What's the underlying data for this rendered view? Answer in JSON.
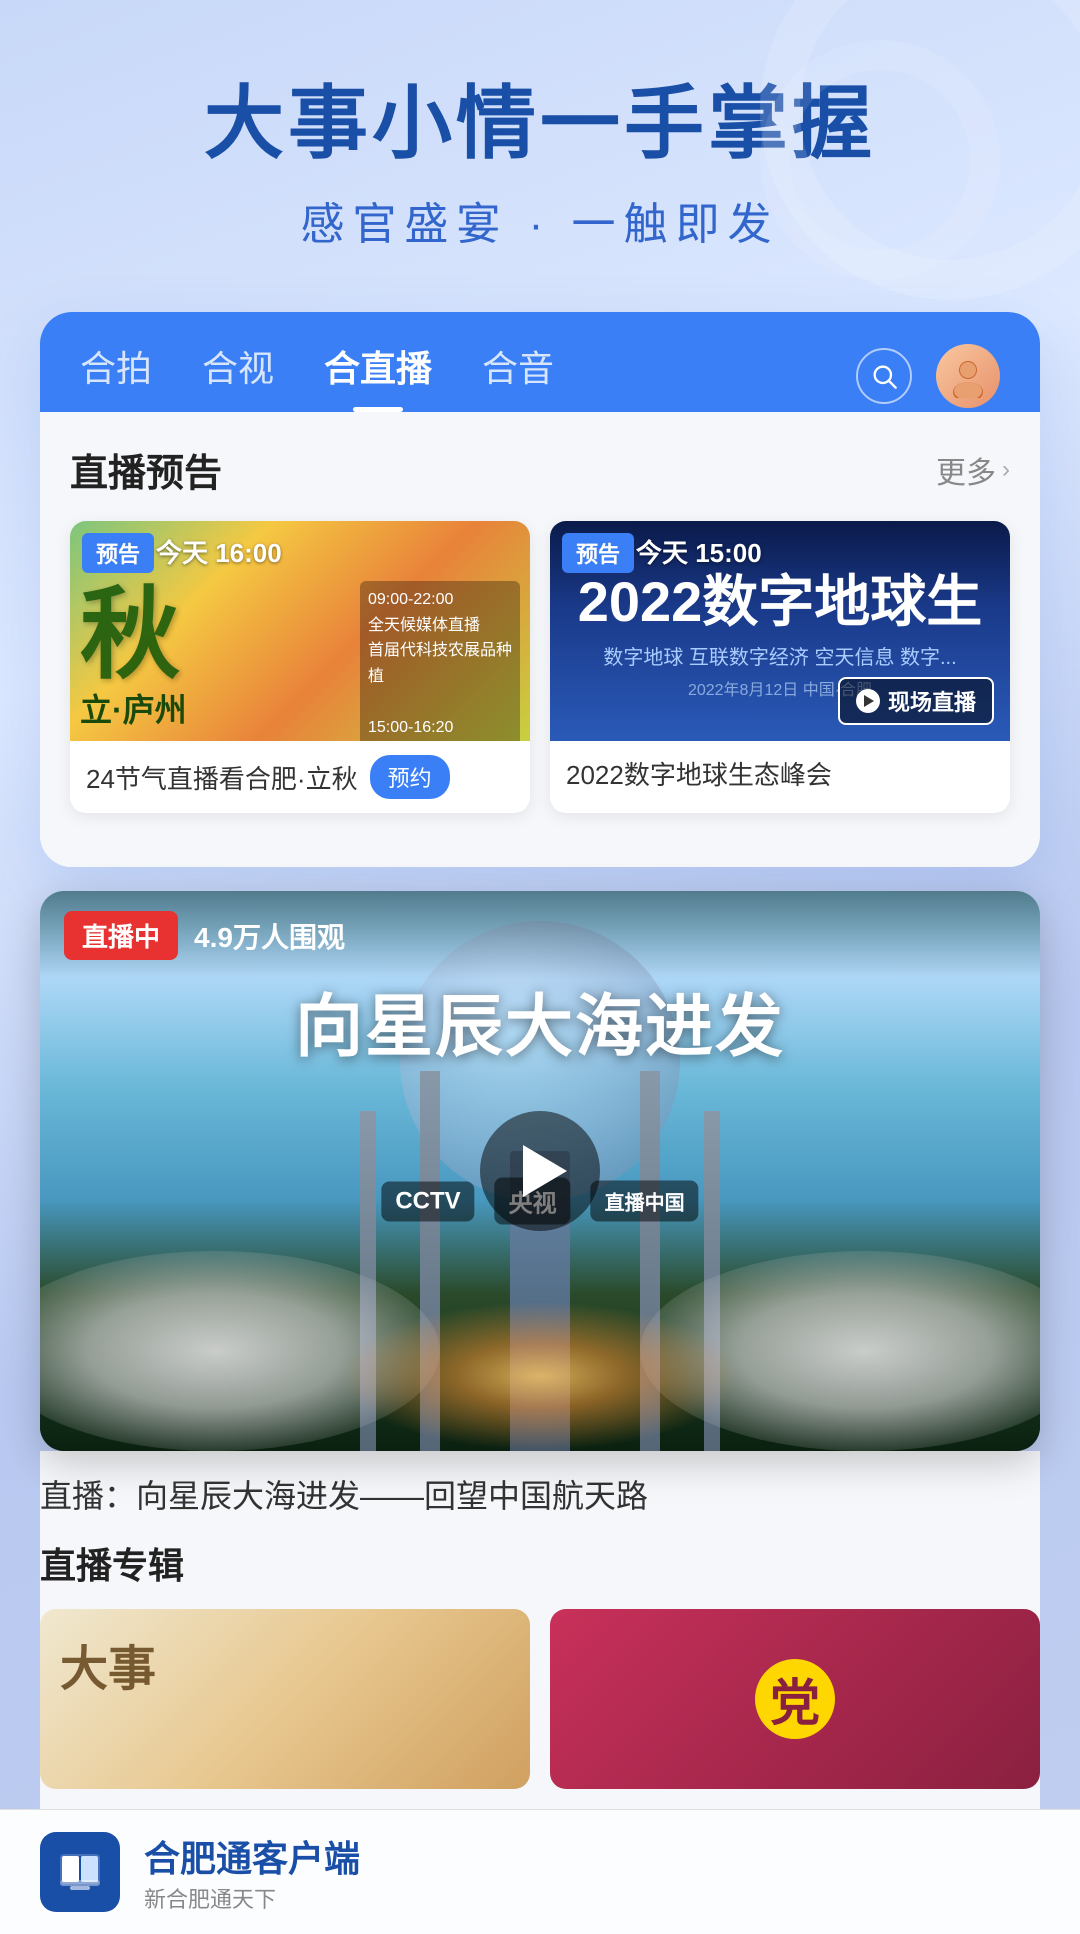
{
  "hero": {
    "title": "大事小情一手掌握",
    "subtitle": "感官盛宴 · 一触即发"
  },
  "tabs": {
    "items": [
      {
        "label": "合拍",
        "active": false
      },
      {
        "label": "合视",
        "active": false
      },
      {
        "label": "合直播",
        "active": true
      },
      {
        "label": "合音",
        "active": false
      }
    ],
    "search_aria": "搜索",
    "avatar_aria": "用户头像"
  },
  "live_preview": {
    "section_title": "直播预告",
    "more_label": "更多",
    "cards": [
      {
        "badge": "预告",
        "time": "今天 16:00",
        "title": "24节气直播看合肥·立秋",
        "reserve_label": "预约"
      },
      {
        "badge": "预告",
        "time": "今天 15:00",
        "title": "2022数字地球生态峰会",
        "live_label": "现场直播"
      }
    ]
  },
  "live_stream": {
    "badge": "直播中",
    "viewers": "4.9万人围观",
    "title": "向星辰大海进发",
    "caption": "直播：向星辰大海进发——回望中国航天路"
  },
  "live_special": {
    "section_title": "直播专辑"
  },
  "bottom_bar": {
    "app_name": "合肥通客户端",
    "tagline": "新合肥通天下"
  }
}
